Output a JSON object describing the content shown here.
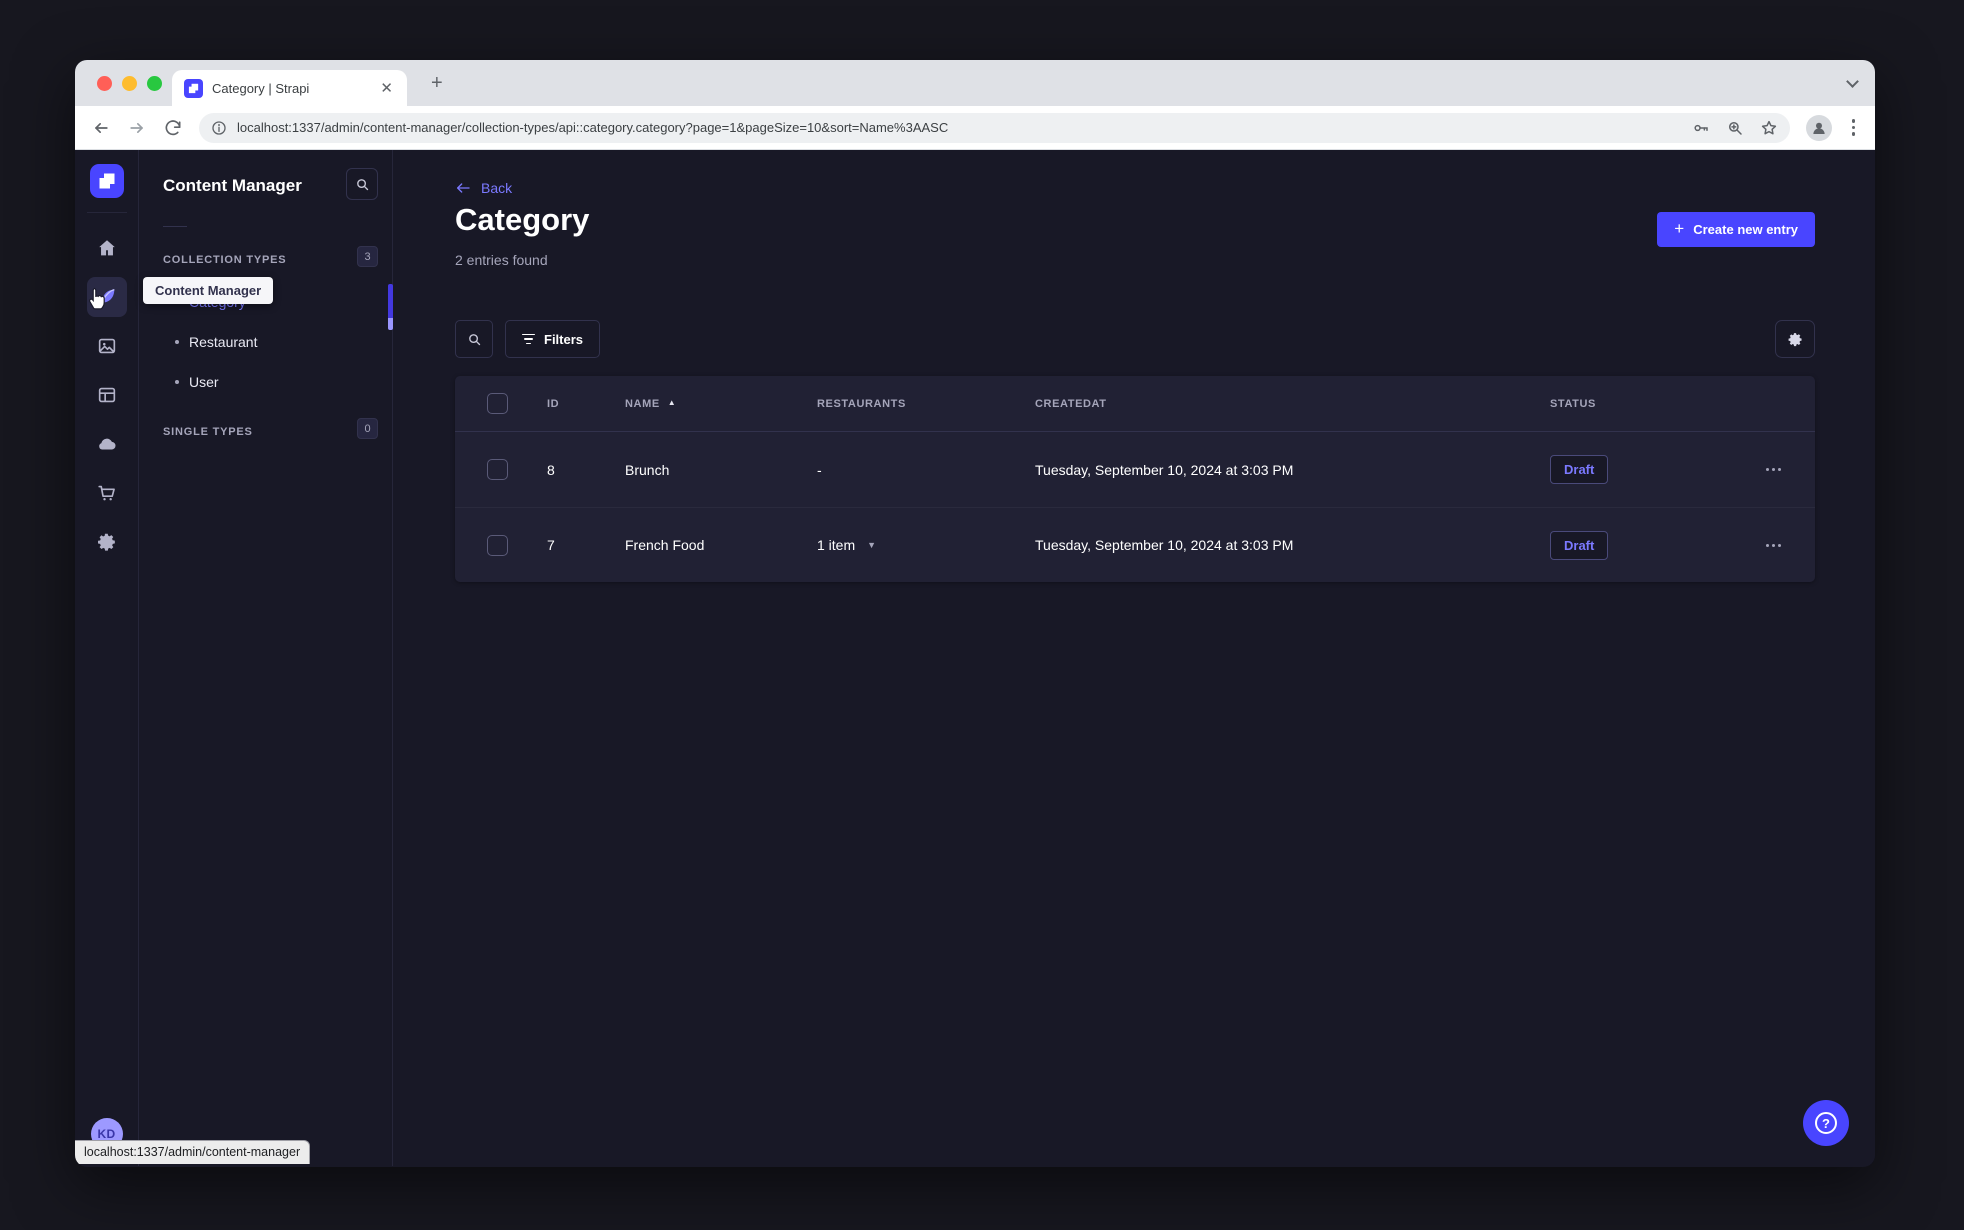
{
  "browser": {
    "tab_title": "Category | Strapi",
    "url": "localhost:1337/admin/content-manager/collection-types/api::category.category?page=1&pageSize=10&sort=Name%3AASC",
    "status_link_preview": "localhost:1337/admin/content-manager"
  },
  "icons": {
    "close": "✕",
    "new_tab": "+",
    "plus": "+",
    "sort_asc": "▲",
    "caret_down": "▼",
    "help": "?"
  },
  "nav_tooltip": "Content Manager",
  "sidebar": {
    "title": "Content Manager",
    "sections": [
      {
        "label": "COLLECTION TYPES",
        "badge": "3",
        "items": [
          {
            "label": "Category",
            "active": true
          },
          {
            "label": "Restaurant",
            "active": false
          },
          {
            "label": "User",
            "active": false
          }
        ]
      },
      {
        "label": "SINGLE TYPES",
        "badge": "0",
        "items": []
      }
    ]
  },
  "user": {
    "initials": "KD"
  },
  "main": {
    "back_label": "Back",
    "title": "Category",
    "subtitle": "2 entries found",
    "create_button_label": "Create new entry",
    "filters_button_label": "Filters",
    "table": {
      "columns": [
        "ID",
        "NAME",
        "RESTAURANTS",
        "CREATEDAT",
        "STATUS"
      ],
      "rows": [
        {
          "id": "8",
          "name": "Brunch",
          "restaurants": "-",
          "has_caret": false,
          "createdAt": "Tuesday, September 10, 2024 at 3:03 PM",
          "status": "Draft"
        },
        {
          "id": "7",
          "name": "French Food",
          "restaurants": "1 item",
          "has_caret": true,
          "createdAt": "Tuesday, September 10, 2024 at 3:03 PM",
          "status": "Draft"
        }
      ]
    }
  },
  "colors": {
    "primary": "#4945ff",
    "primary_light": "#7b79ff",
    "app_background": "#181826",
    "card_background": "#212134",
    "muted_text": "#a5a5ba"
  }
}
